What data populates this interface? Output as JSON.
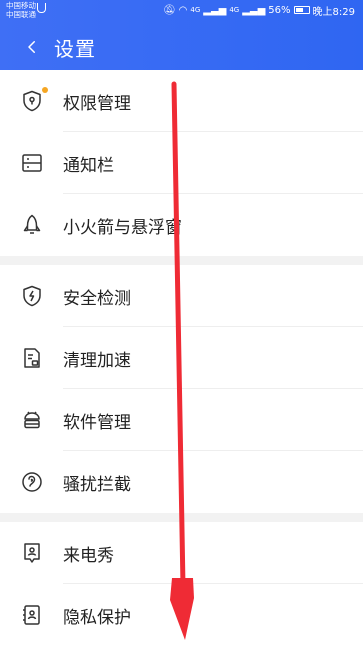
{
  "status_bar": {
    "carrier_1": "中国移动",
    "carrier_2": "中国联通",
    "network_1": "4G",
    "network_2": "4G",
    "battery": "56%",
    "time": "晚上8:29"
  },
  "header": {
    "title": "设置"
  },
  "items": [
    {
      "label": "权限管理",
      "icon": "shield-lock-icon"
    },
    {
      "label": "通知栏",
      "icon": "notification-bar-icon"
    },
    {
      "label": "小火箭与悬浮窗",
      "icon": "rocket-icon"
    },
    {
      "label": "安全检测",
      "icon": "shield-bolt-icon"
    },
    {
      "label": "清理加速",
      "icon": "document-clean-icon"
    },
    {
      "label": "软件管理",
      "icon": "android-icon"
    },
    {
      "label": "骚扰拦截",
      "icon": "ear-block-icon"
    },
    {
      "label": "来电秀",
      "icon": "caller-show-icon"
    },
    {
      "label": "隐私保护",
      "icon": "privacy-icon"
    }
  ],
  "colors": {
    "header": "#3f6ff5",
    "badge_dot": "#f5a623",
    "annotation_arrow": "#ef2b35"
  }
}
